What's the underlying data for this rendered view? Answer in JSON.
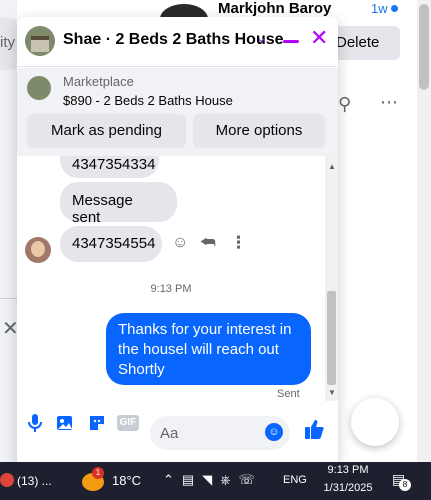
{
  "background": {
    "left_partial_text": "ity",
    "contact_name": "Markjohn Baroy",
    "contact_time": "1w",
    "delete_label": "Delete",
    "search_icon": "search-icon",
    "more_icon": "more-dots-icon",
    "close_glyph": "✕"
  },
  "chat": {
    "title": "Shae · 2 Beds 2 Baths House",
    "chevron": "⌄",
    "minimize_icon": "minimize-icon",
    "close_glyph": "✕",
    "accent_color": "#b300ff",
    "listing": {
      "label": "Marketplace",
      "description": "$890 - 2 Beds 2 Baths House",
      "mark_pending_label": "Mark as pending",
      "more_options_label": "More options"
    },
    "messages": {
      "incoming_partial": "4347354334",
      "message_sent": "Message sent",
      "incoming_phone": "4347354554",
      "timestamp": "9:13 PM",
      "outgoing": "Thanks for your interest in the housel will reach out Shortly",
      "outgoing_status": "Sent"
    },
    "composer": {
      "placeholder": "Aa",
      "gif_label": "GIF"
    },
    "brand_color": "#0866ff"
  },
  "taskbar": {
    "app_label": "(13) ...",
    "weather_badge": "1",
    "temperature": "18°C",
    "language": "ENG",
    "time": "9:13 PM",
    "date": "1/31/2025",
    "notification_count": "8"
  }
}
